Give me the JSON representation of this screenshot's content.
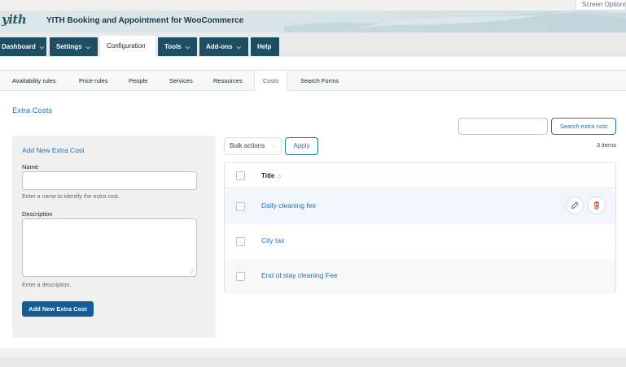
{
  "screen_options": {
    "label": "Screen Options"
  },
  "banner": {
    "logo": "yith",
    "title": "YITH Booking and Appointment for WooCommerce"
  },
  "nav": [
    {
      "label": "Dashboard",
      "dropdown": true
    },
    {
      "label": "Settings",
      "dropdown": true
    },
    {
      "label": "Configuration",
      "dropdown": false,
      "active": true
    },
    {
      "label": "Tools",
      "dropdown": true
    },
    {
      "label": "Add-ons",
      "dropdown": true
    },
    {
      "label": "Help",
      "dropdown": false
    }
  ],
  "subtabs": [
    {
      "label": "Availability rules"
    },
    {
      "label": "Price rules"
    },
    {
      "label": "People"
    },
    {
      "label": "Services"
    },
    {
      "label": "Resources"
    },
    {
      "label": "Costs",
      "active": true
    },
    {
      "label": "Search Forms"
    }
  ],
  "section_title": "Extra Costs",
  "search": {
    "placeholder": "",
    "button_label": "Search extra cost"
  },
  "form": {
    "title": "Add New Extra Cost",
    "name_label": "Name",
    "name_value": "",
    "name_hint": "Enter a name to identify the extra cost.",
    "description_label": "Description",
    "description_value": "",
    "description_hint": "Enter a description.",
    "submit_label": "Add New Extra Cost"
  },
  "table": {
    "bulk_actions": "Bulk actions",
    "apply_label": "Apply",
    "items_count": "3 items",
    "column_title": "Title",
    "rows": [
      {
        "title": "Daily cleaning fee"
      },
      {
        "title": "City tax"
      },
      {
        "title": "End of stay cleaning Fee"
      }
    ]
  },
  "colors": {
    "accent": "#2271b1",
    "nav": "#1d4e62",
    "primary": "#135e96",
    "danger": "#d63638"
  }
}
